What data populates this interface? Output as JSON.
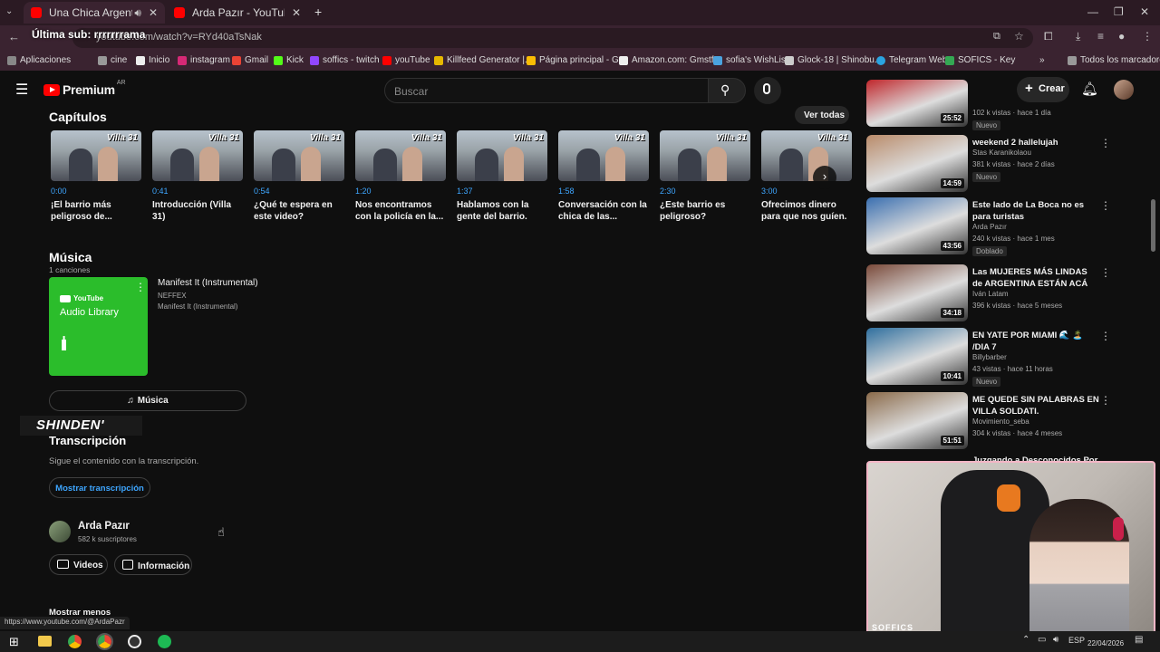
{
  "browser": {
    "tabs": [
      {
        "title": "Una Chica Argentina Me Lleva..."
      },
      {
        "title": "Arda Pazır - YouTube"
      }
    ],
    "url": "youtube.com/watch?v=RYd40aTsNak",
    "overlay_text": "Última sub: rrrrrrrama",
    "status_url": "https://www.youtube.com/@ArdaPazr",
    "bookmarks": [
      "Aplicaciones",
      "cine",
      "Inicio",
      "instagram",
      "Gmail",
      "Kick",
      "soffics - twitch",
      "youTube",
      "Killfeed Generator |...",
      "Página principal - G...",
      "Amazon.com: Gmstf...",
      "sofia's WishList",
      "Glock-18 | Shinobu...",
      "Telegram Web",
      "SOFICS - Key"
    ],
    "bookmarks_more": "Todos los marcadores"
  },
  "youtube": {
    "logo": "Premium",
    "region": "AR",
    "search_placeholder": "Buscar",
    "create_label": "Crear"
  },
  "chapters": {
    "heading": "Capítulos",
    "see_all": "Ver todas",
    "items": [
      {
        "time": "0:00",
        "title": "¡El barrio más peligroso de..."
      },
      {
        "time": "0:41",
        "title": "Introducción (Villa 31)"
      },
      {
        "time": "0:54",
        "title": "¿Qué te espera en este video?"
      },
      {
        "time": "1:20",
        "title": "Nos encontramos con la policía en la..."
      },
      {
        "time": "1:37",
        "title": "Hablamos con la gente del barrio."
      },
      {
        "time": "1:58",
        "title": "Conversación con la chica de las..."
      },
      {
        "time": "2:30",
        "title": "¿Este barrio es peligroso?"
      },
      {
        "time": "3:00",
        "title": "Ofrecimos dinero para que nos guíen."
      }
    ],
    "thumb_text": "Villa 31"
  },
  "music": {
    "heading": "Música",
    "count": "1 canciones",
    "song": "Manifest It (Instrumental)",
    "artist": "NEFFEX",
    "album": "Manifest It (Instrumental)",
    "cover_brand": "YouTube",
    "cover_text": "Audio Library",
    "button_label": "Música"
  },
  "watermark": "SHINDEN'",
  "transcript": {
    "heading": "Transcripción",
    "desc": "Sigue el contenido con la transcripción.",
    "button": "Mostrar transcripción"
  },
  "channel": {
    "name": "Arda Pazır",
    "subs": "582 k suscriptores",
    "videos_label": "Videos",
    "info_label": "Información",
    "show_less": "Mostrar menos"
  },
  "related": [
    {
      "title": "",
      "channel": "",
      "meta": "102 k vistas · hace 1 día",
      "badge": "Nuevo",
      "duration": "25:52",
      "color": "#c0262b"
    },
    {
      "title": "weekend 2 hallelujah",
      "channel": "Stas Karanikolaou",
      "meta": "381 k vistas · hace 2 días",
      "badge": "Nuevo",
      "duration": "14:59",
      "color": "#b98b6a"
    },
    {
      "title": "Este lado de La Boca no es para turistas",
      "channel": "Arda Pazır",
      "meta": "240 k vistas · hace 1 mes",
      "badge": "Doblado",
      "duration": "43:56",
      "color": "#3a6fb0"
    },
    {
      "title": "Las MUJERES MÁS LINDAS de ARGENTINA ESTÁN ACÁ",
      "channel": "Iván Latam",
      "meta": "396 k vistas · hace 5 meses",
      "badge": "",
      "duration": "34:18",
      "color": "#7a4a3a"
    },
    {
      "title": "EN YATE POR MIAMI 🌊 🏝️ /DIA 7",
      "channel": "Billybarber",
      "meta": "43 vistas · hace 11 horas",
      "badge": "Nuevo",
      "duration": "10:41",
      "color": "#2f6f9e"
    },
    {
      "title": "ME QUEDE SIN PALABRAS EN VILLA SOLDATI.",
      "channel": "Movimiento_seba",
      "meta": "304 k vistas · hace 4 meses",
      "badge": "",
      "duration": "51:51",
      "color": "#8a6a4a"
    }
  ],
  "related_partial_title": "Juzgando a Desconocidos Por...",
  "webcam": {
    "label": "SOFFICS"
  },
  "taskbar": {
    "lang": "ESP",
    "date": "22/04/2026"
  },
  "colors": {
    "accent_blue": "#3ea6ff",
    "yt_red": "#ff0000",
    "music_green": "#2bbd2b"
  }
}
